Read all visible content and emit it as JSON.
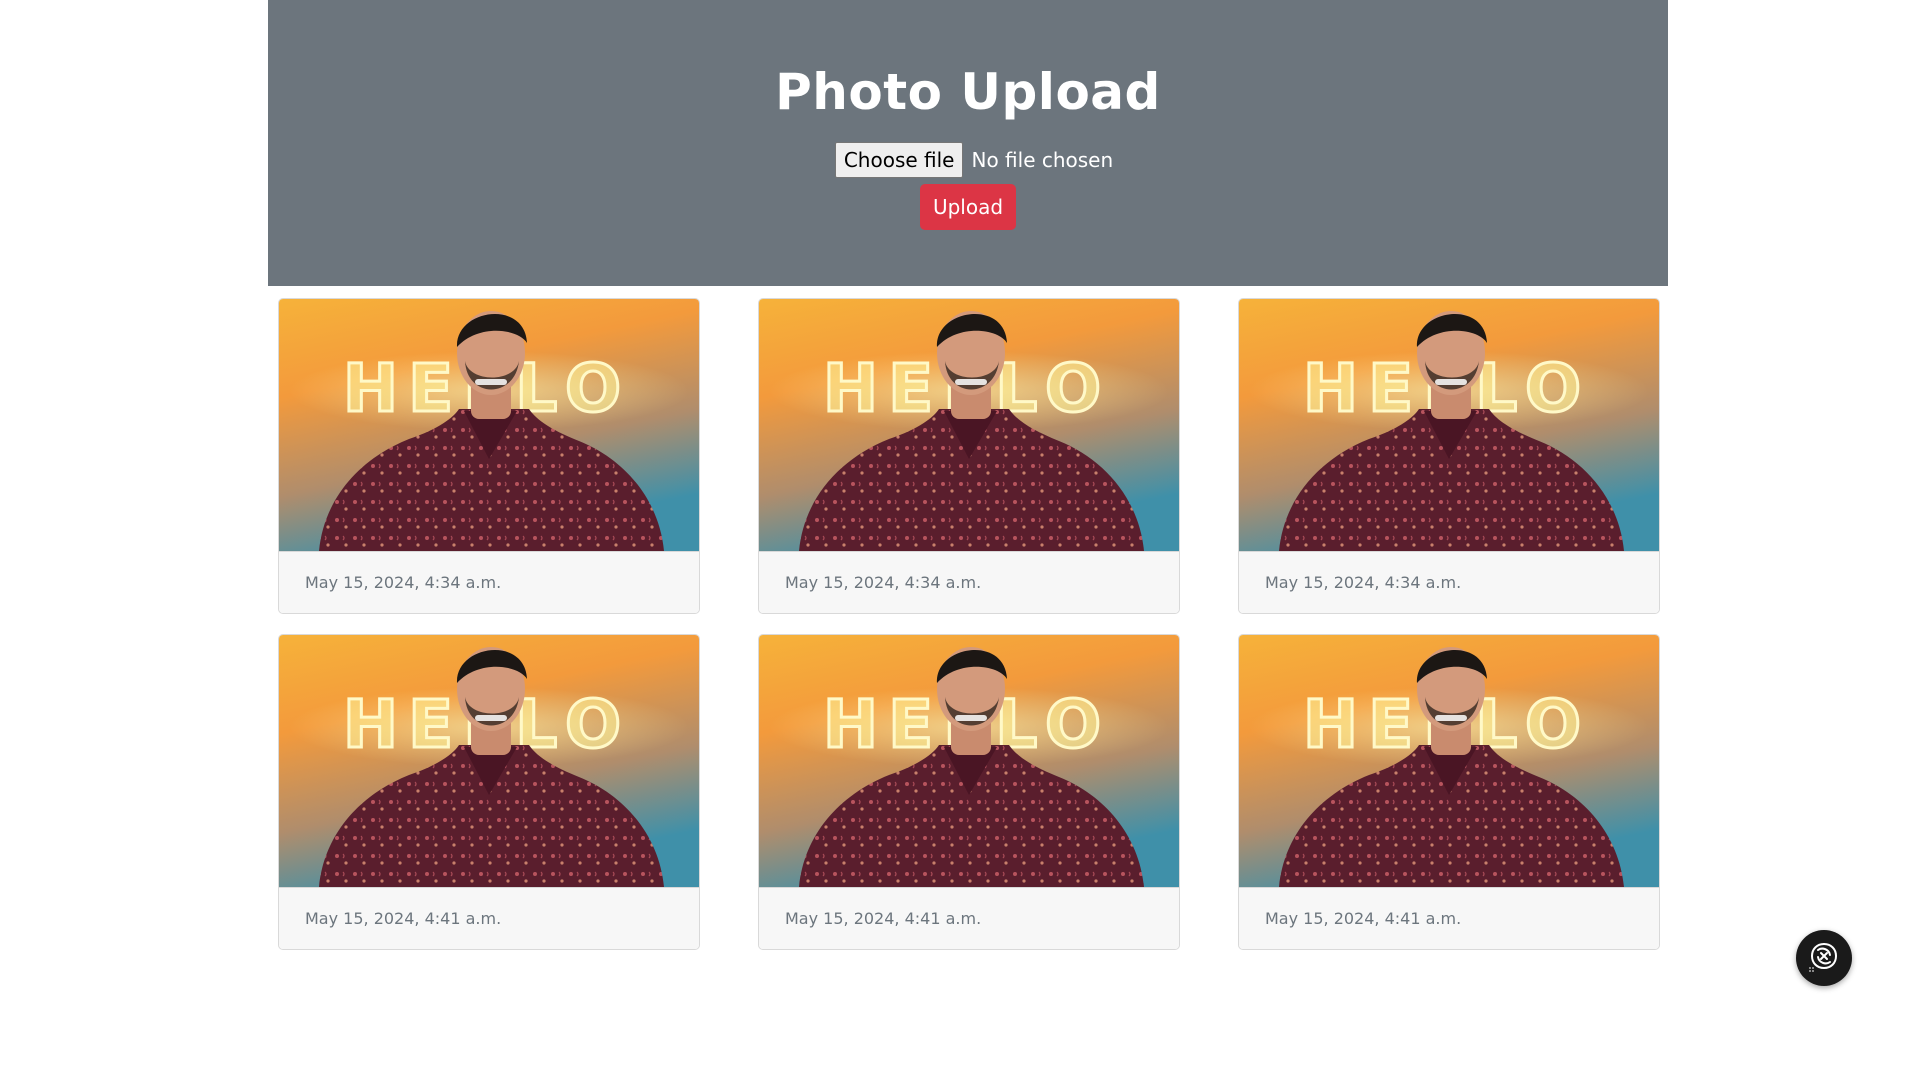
{
  "header": {
    "title": "Photo Upload",
    "choose_file_label": "Choose file",
    "file_status": "No file chosen",
    "upload_label": "Upload"
  },
  "photos": [
    {
      "timestamp": "May 15, 2024, 4:34 a.m."
    },
    {
      "timestamp": "May 15, 2024, 4:34 a.m."
    },
    {
      "timestamp": "May 15, 2024, 4:34 a.m."
    },
    {
      "timestamp": "May 15, 2024, 4:41 a.m."
    },
    {
      "timestamp": "May 15, 2024, 4:41 a.m."
    },
    {
      "timestamp": "May 15, 2024, 4:41 a.m."
    }
  ],
  "photo_overlay_text": "HELLO",
  "colors": {
    "hero_bg": "#6c757d",
    "upload_button": "#dc3545",
    "footer_text": "#6c757d"
  },
  "icons": {
    "assistant": "spiral-logo-icon"
  }
}
